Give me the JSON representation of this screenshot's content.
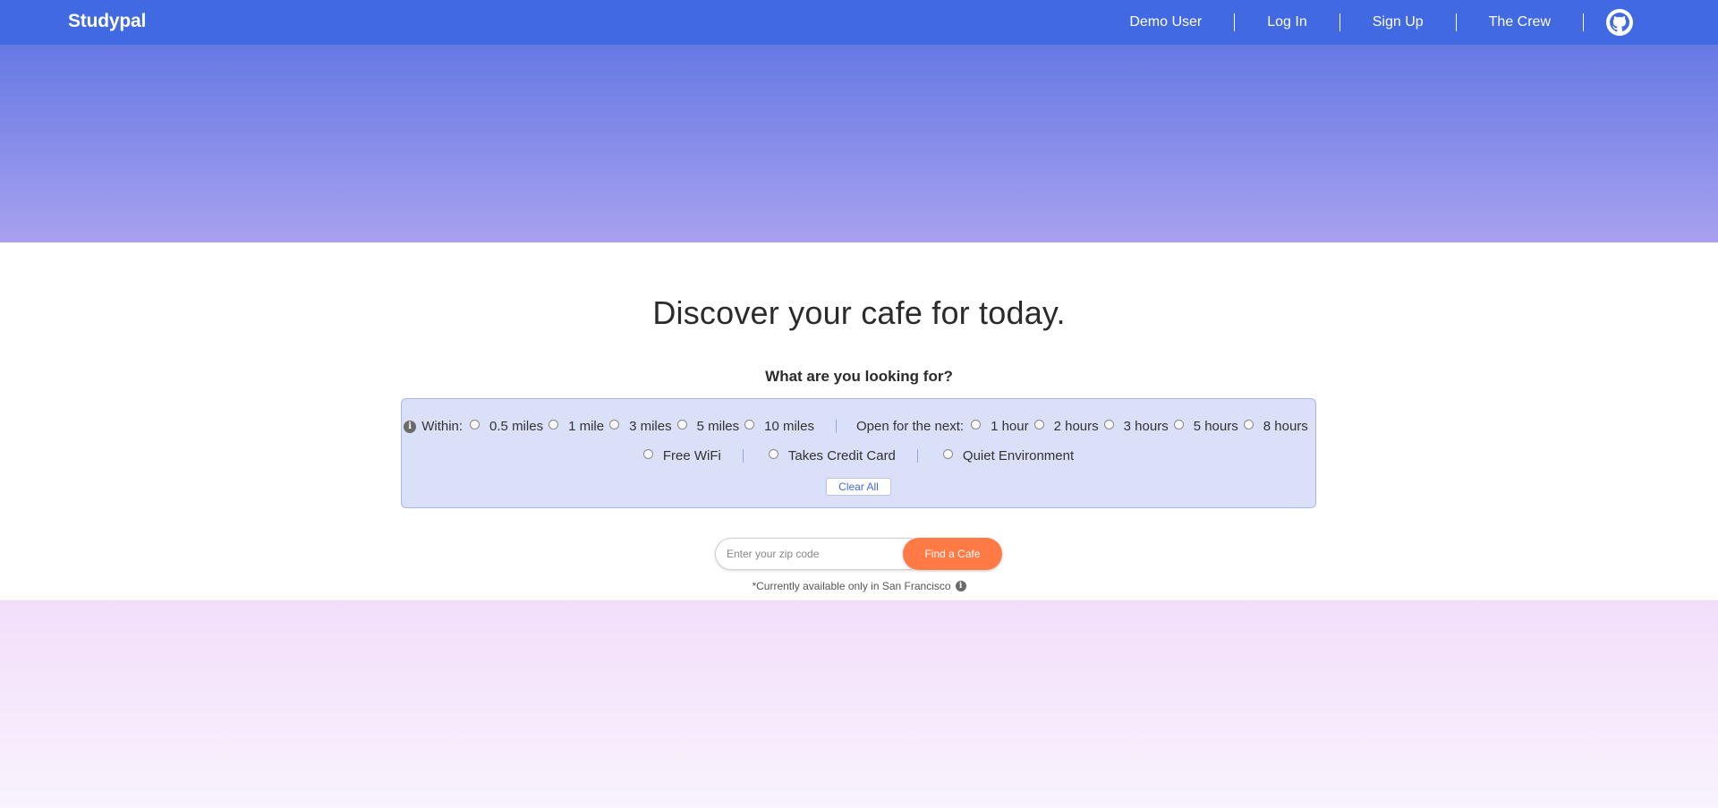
{
  "nav": {
    "brand": "Studypal",
    "links": [
      "Demo User",
      "Log In",
      "Sign Up",
      "The Crew"
    ],
    "github_icon": "github-icon"
  },
  "main": {
    "headline": "Discover your cafe for today.",
    "subhead": "What are you looking for?"
  },
  "filters": {
    "info_icon": "info-icon",
    "within_label": "Within:",
    "within_options": [
      "0.5 miles",
      "1 mile",
      "3 miles",
      "5 miles",
      "10 miles"
    ],
    "open_label": "Open for the next:",
    "open_options": [
      "1 hour",
      "2 hours",
      "3 hours",
      "5 hours",
      "8 hours"
    ],
    "amenities": [
      "Free WiFi",
      "Takes Credit Card",
      "Quiet Environment"
    ],
    "clear_label": "Clear All"
  },
  "search": {
    "placeholder": "Enter your zip code",
    "button_label": "Find a Cafe",
    "note": "*Currently available only in San Francisco"
  },
  "colors": {
    "navbar": "#4169e1",
    "accent_button": "#ff7a45",
    "filter_panel": "#d9e0f7"
  }
}
